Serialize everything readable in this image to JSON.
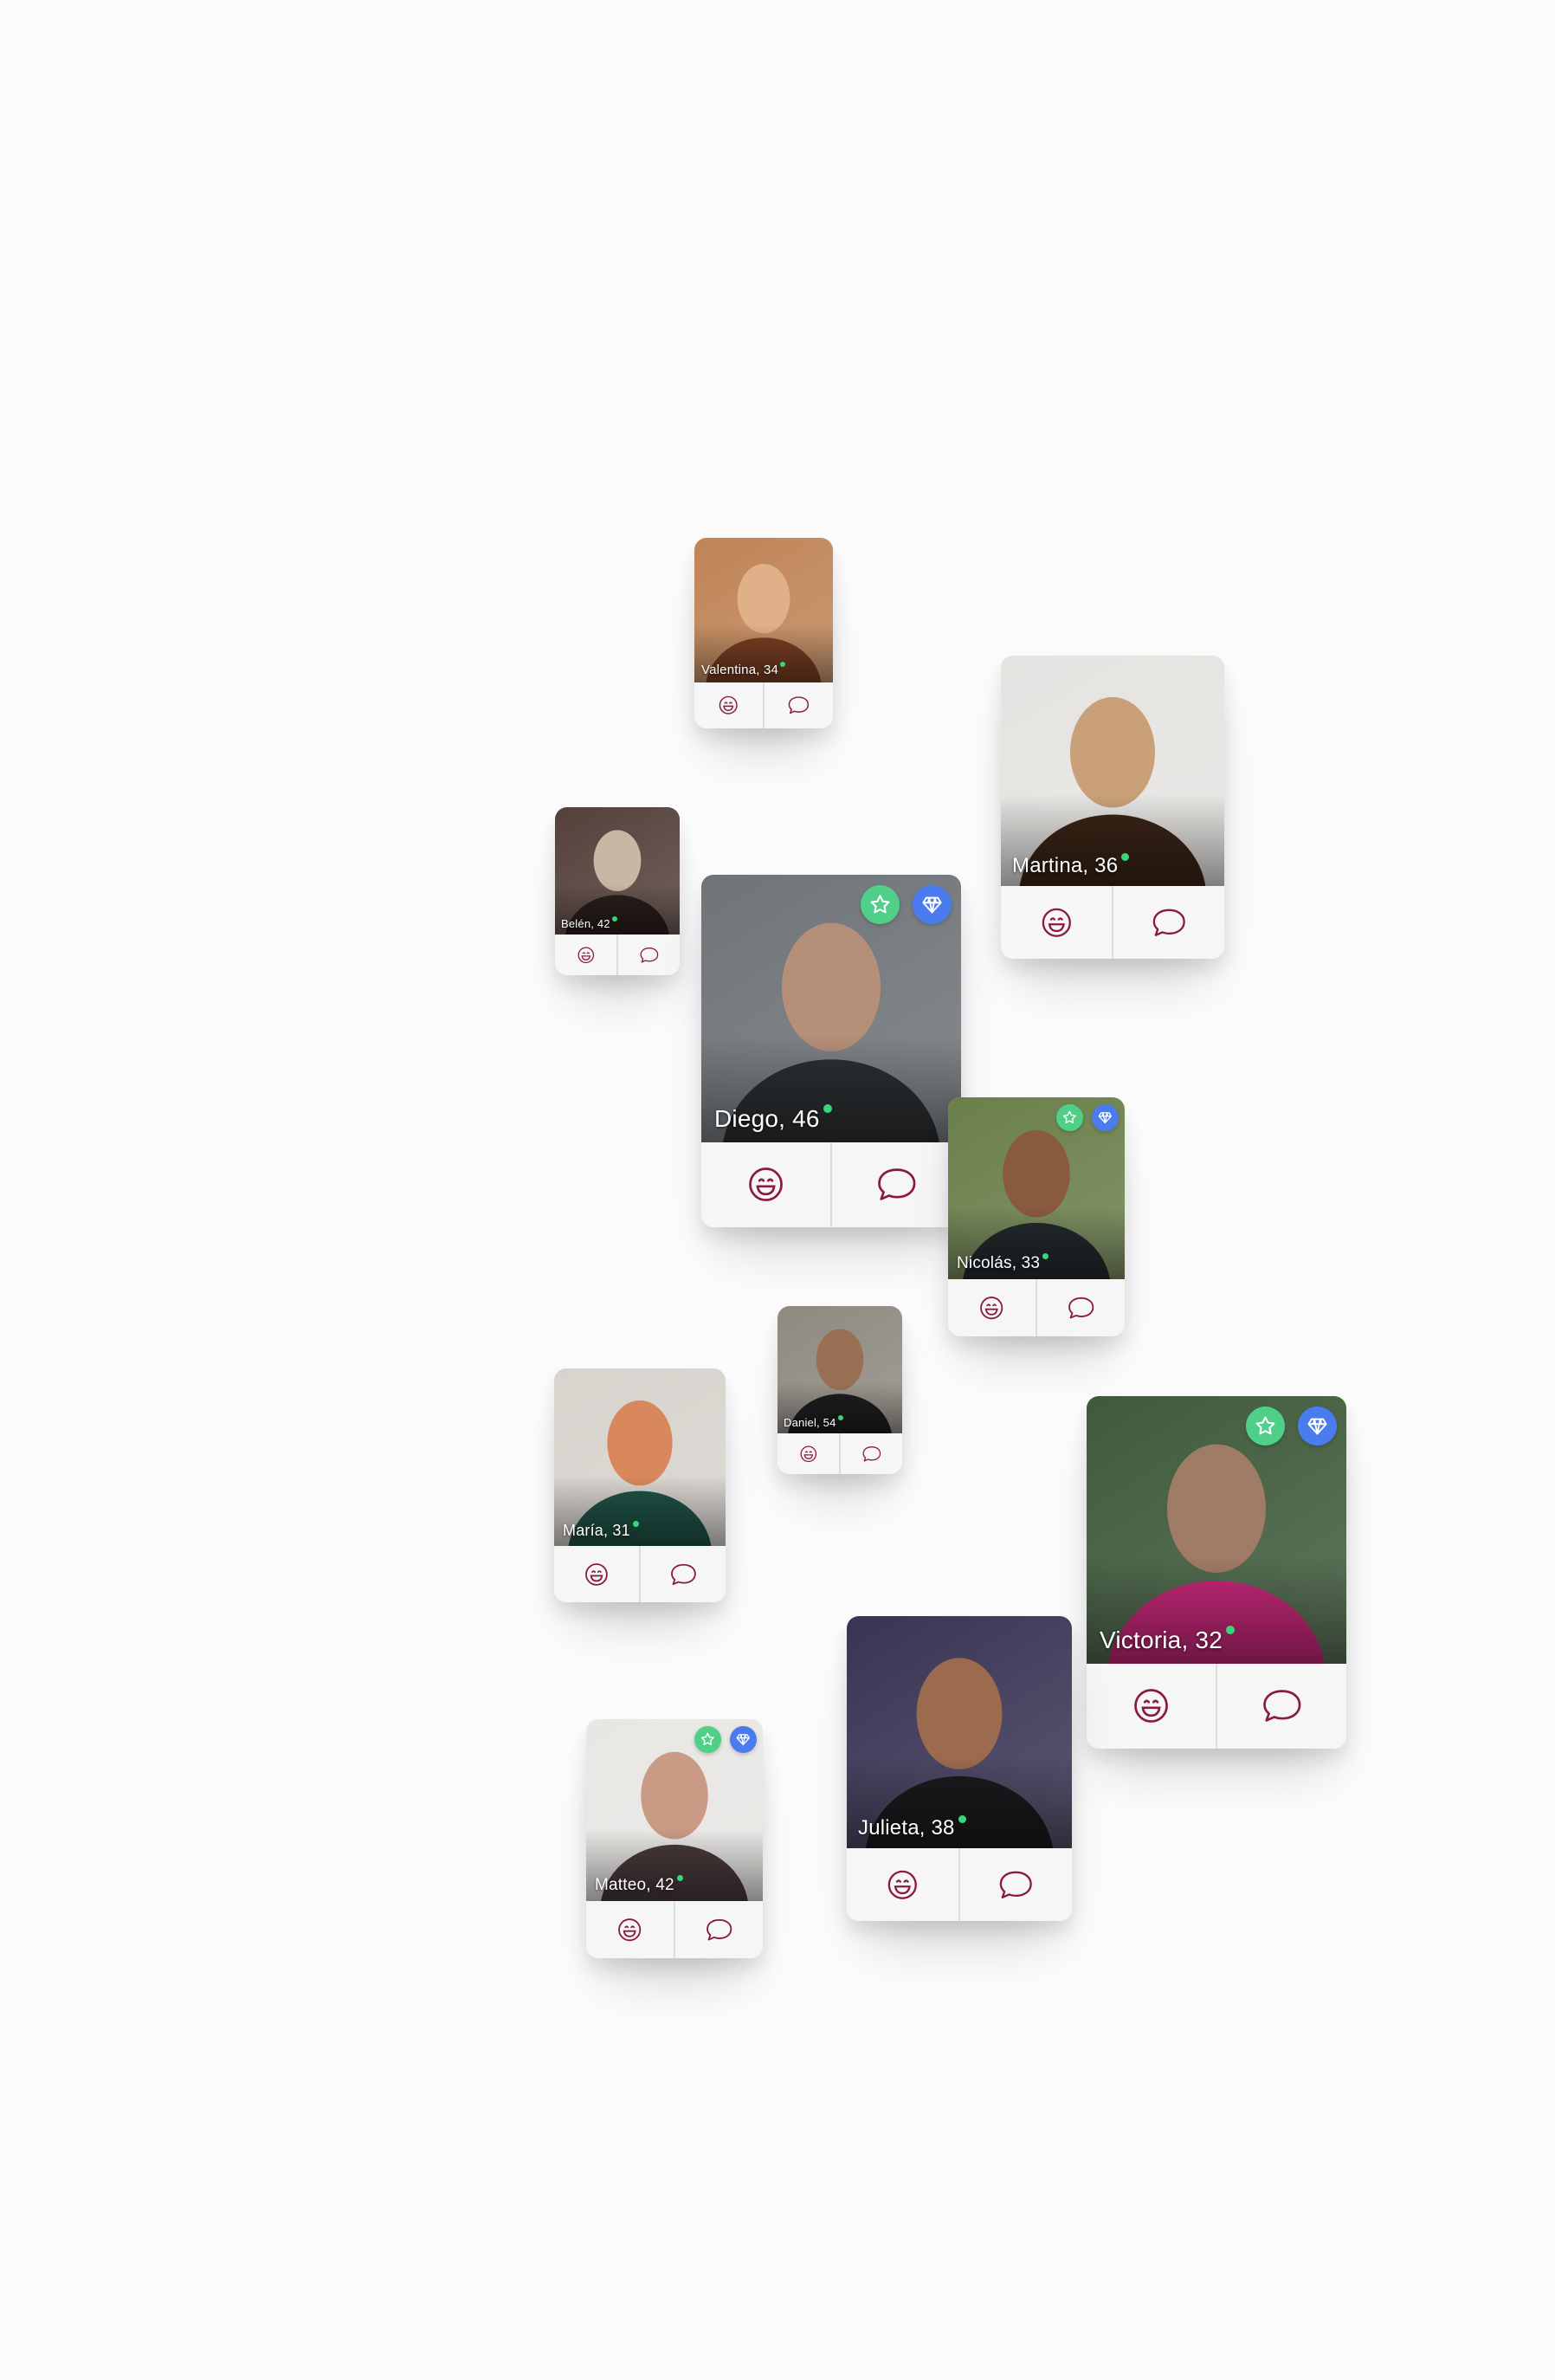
{
  "profiles": [
    {
      "id": "valentina",
      "name": "Valentina, 34",
      "online": true,
      "badges": [],
      "palette": [
        "#c08456",
        "#7a3f22",
        "#e0b089"
      ]
    },
    {
      "id": "martina",
      "name": "Martina, 36",
      "online": true,
      "badges": [],
      "palette": [
        "#e6e4e1",
        "#3a2516",
        "#c9a078"
      ]
    },
    {
      "id": "belen",
      "name": "Belén, 42",
      "online": true,
      "badges": [],
      "palette": [
        "#55403a",
        "#2a1f1c",
        "#c9b7a5"
      ]
    },
    {
      "id": "diego",
      "name": "Diego, 46",
      "online": true,
      "badges": [
        "star-badge-icon",
        "diamond-badge-icon"
      ],
      "palette": [
        "#6e7478",
        "#2d3033",
        "#b58f78"
      ]
    },
    {
      "id": "nicolas",
      "name": "Nicolás, 33",
      "online": true,
      "badges": [
        "star-badge-icon",
        "diamond-badge-icon"
      ],
      "palette": [
        "#6a7f4a",
        "#242a2e",
        "#8a5a3e"
      ]
    },
    {
      "id": "daniel",
      "name": "Daniel, 54",
      "online": true,
      "badges": [],
      "palette": [
        "#8f8a80",
        "#1e1e22",
        "#9a7055"
      ]
    },
    {
      "id": "maria",
      "name": "María, 31",
      "online": true,
      "badges": [],
      "palette": [
        "#d7d3cd",
        "#1f5447",
        "#d9885d"
      ]
    },
    {
      "id": "victoria",
      "name": "Victoria, 32",
      "online": true,
      "badges": [
        "star-badge-icon",
        "diamond-badge-icon"
      ],
      "palette": [
        "#3f5a3b",
        "#c8287a",
        "#a07b66"
      ]
    },
    {
      "id": "julieta",
      "name": "Julieta, 38",
      "online": true,
      "badges": [],
      "palette": [
        "#3a3454",
        "#1b1b1e",
        "#9c6b4f"
      ]
    },
    {
      "id": "matteo",
      "name": "Matteo, 42",
      "online": true,
      "badges": [
        "star-badge-icon",
        "diamond-badge-icon"
      ],
      "palette": [
        "#e9e7e4",
        "#4a3a3c",
        "#c99a84"
      ]
    }
  ],
  "actions": {
    "smile_icon": "smile-icon",
    "chat_icon": "chat-bubble-icon",
    "accent": "#8a1a3e"
  }
}
